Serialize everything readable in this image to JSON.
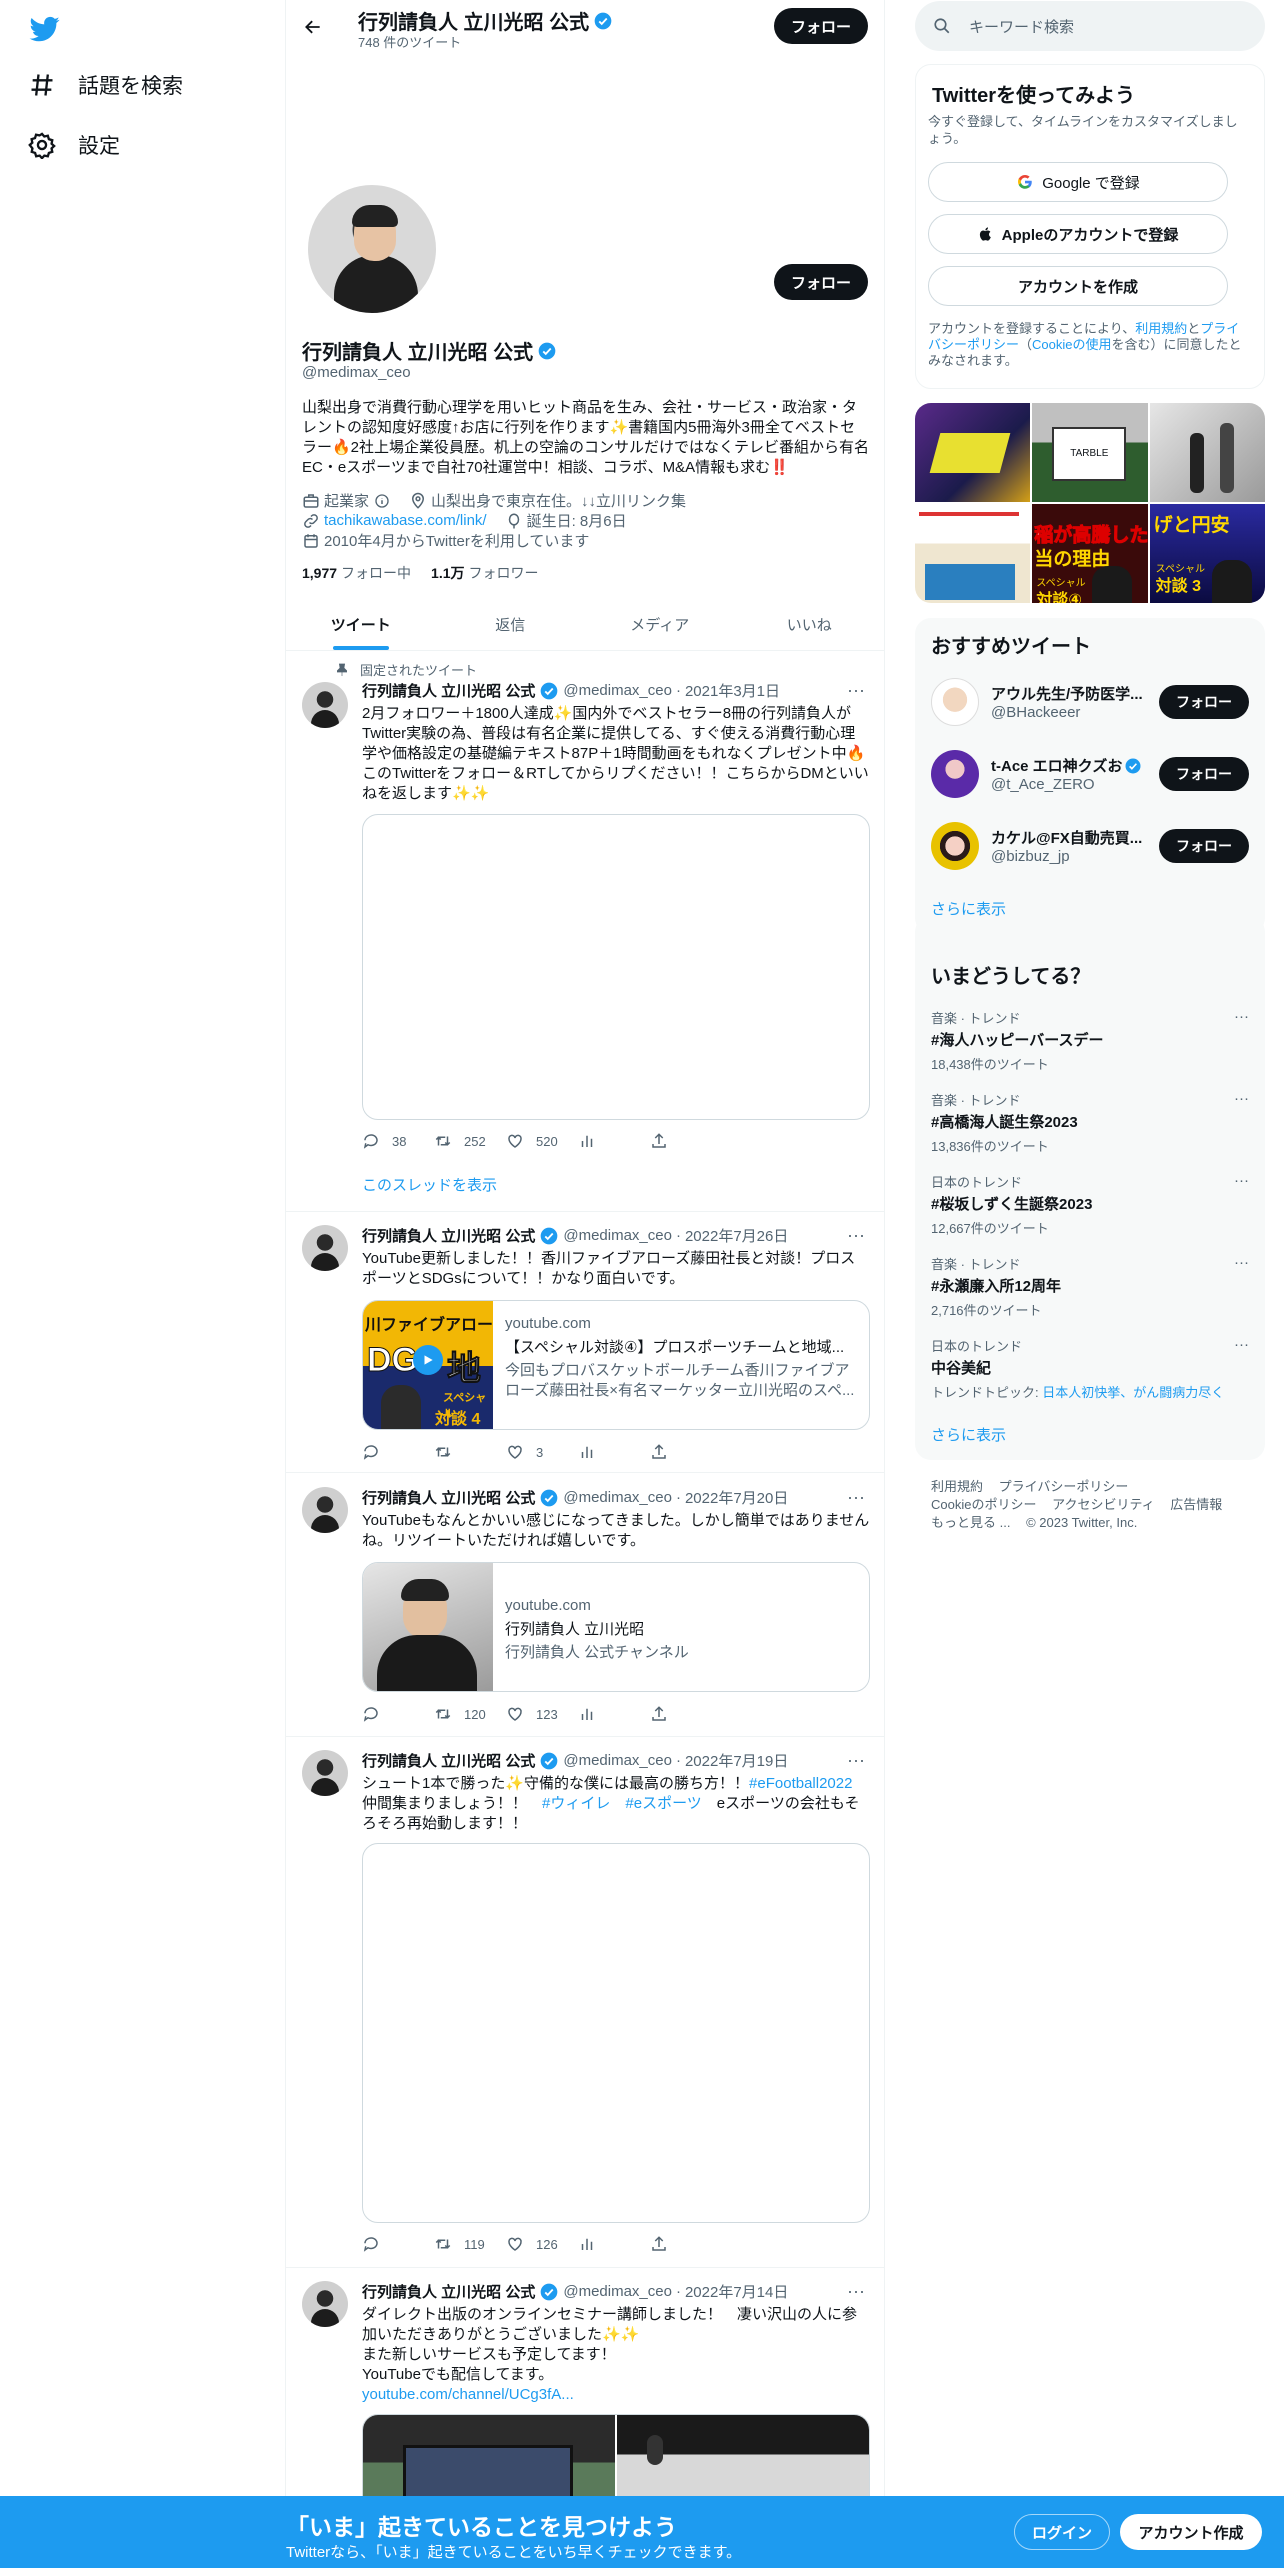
{
  "nav": {
    "explore_label": "話題を検索",
    "settings_label": "設定"
  },
  "header": {
    "title": "行列請負人 立川光昭 公式",
    "tweet_count": "748 件のツイート",
    "follow_label": "フォロー"
  },
  "profile": {
    "name": "行列請負人 立川光昭 公式",
    "handle": "@medimax_ceo",
    "follow_label": "フォロー",
    "bio": "山梨出身で消費行動心理学を用いヒット商品を生み、会社・サービス・政治家・タレントの認知度好感度↑お店に行列を作ります✨書籍国内5冊海外3冊全てベストセラー🔥2社上場企業役員歴。机上の空論のコンサルだけではなくテレビ番組から有名EC・eスポーツまで自社70社運営中！相談、コラボ、M&A情報も求む‼️",
    "profession": "起業家",
    "location": "山梨出身で東京在住。↓↓立川リンク集",
    "url": "tachikawabase.com/link/",
    "birthday": "誕生日: 8月6日",
    "joined": "2010年4月からTwitterを利用しています",
    "following_count": "1,977",
    "following_label": "フォロー中",
    "followers_count": "1.1万",
    "followers_label": "フォロワー"
  },
  "tabs": [
    "ツイート",
    "返信",
    "メディア",
    "いいね"
  ],
  "tweets": [
    {
      "pinned_label": "固定されたツイート",
      "name": "行列請負人 立川光昭 公式",
      "handle": "@medimax_ceo",
      "date": "2021年3月1日",
      "text": "2月フォロワー＋1800人達成✨国内外でベストセラー8冊の行列請負人がTwitter実験の為、普段は有名企業に提供してる、すぐ使える消費行動心理学や価格設定の基礎編テキスト87P＋1時間動画をもれなくプレゼント中🔥このTwitterをフォロー＆RTしてからリプください！！こちらからDMといいねを返します✨✨",
      "replies": "38",
      "retweets": "252",
      "likes": "520",
      "thread_link": "このスレッドを表示"
    },
    {
      "name": "行列請負人 立川光昭 公式",
      "handle": "@medimax_ceo",
      "date": "2022年7月26日",
      "text": "YouTube更新しました！！香川ファイブアローズ藤田社長と対談！プロスポーツとSDGsについて！！かなり面白いです。",
      "card_domain": "youtube.com",
      "card_title": "【スペシャル対談④】プロスポーツチームと地域...",
      "card_desc": "今回もプロバスケットボールチーム香川ファイブアローズ藤田社長×有名マーケッター立川光昭のスペ...",
      "thumb_text_1": "川ファイブアロー",
      "thumb_text_2": "DG",
      "thumb_text_3": "地",
      "thumb_text_4": "スペシャル",
      "thumb_text_5": "対談 4",
      "replies": "",
      "retweets": "",
      "likes": "3"
    },
    {
      "name": "行列請負人 立川光昭 公式",
      "handle": "@medimax_ceo",
      "date": "2022年7月20日",
      "text": "YouTubeもなんとかいい感じになってきました。しかし簡単ではありませんね。リツイートいただければ嬉しいです。",
      "card_domain": "youtube.com",
      "card_title": "行列請負人 立川光昭",
      "card_desc": "行列請負人 公式チャンネル",
      "replies": "",
      "retweets": "120",
      "likes": "123"
    },
    {
      "name": "行列請負人 立川光昭 公式",
      "handle": "@medimax_ceo",
      "date": "2022年7月19日",
      "text_before": "シュート1本で勝った✨守備的な僕には最高の勝ち方！！",
      "hashtag1": "#eFootball2022",
      "text_mid": "仲間集まりましょう！！",
      "hashtag2": "#ウィイレ",
      "hashtag3": "#eスポーツ",
      "text_after": "eスポーツの会社もそろそろ再始動します！！",
      "replies": "",
      "retweets": "119",
      "likes": "126"
    },
    {
      "name": "行列請負人 立川光昭 公式",
      "handle": "@medimax_ceo",
      "date": "2022年7月14日",
      "text": "ダイレクト出版のオンラインセミナー講師しました！　凄い沢山の人に参加いただきありがとうございました✨✨\nまた新しいサービスも予定してます！\nYouTubeでも配信してます。",
      "link": "youtube.com/channel/UCg3fA..."
    }
  ],
  "search": {
    "placeholder": "キーワード検索"
  },
  "signup_panel": {
    "title": "Twitterを使ってみよう",
    "subtitle": "今すぐ登録して、タイムラインをカスタマイズしましょう。",
    "google_label": "Google で登録",
    "apple_label": "Appleのアカウントで登録",
    "create_label": "アカウントを作成",
    "legal_1": "アカウントを登録することにより、",
    "legal_terms": "利用規約",
    "legal_and": "と",
    "legal_privacy": "プライバシーポリシー",
    "legal_open": "（",
    "legal_cookie": "Cookieの使用",
    "legal_2": "を含む）に同意したとみなされます。"
  },
  "media_grid": {
    "tile_3_text": "げと円安",
    "tile_4_text": "稲が高騰した",
    "tile_4_sub": "当の理由",
    "tile_5_text": "スペシャル",
    "tile_5_sub": "対談④",
    "tile_6_text": "スペシャル",
    "tile_6_sub": "対談 3",
    "tile_2_text": "TARBLE"
  },
  "who_to_follow": {
    "title": "おすすめツイート",
    "users": [
      {
        "name": "アウル先生/予防医学...",
        "handle": "@BHackeeer",
        "verified": false
      },
      {
        "name": "t-Ace エロ神クズお",
        "handle": "@t_Ace_ZERO",
        "verified": true
      },
      {
        "name": "カケル@FX自動売買...",
        "handle": "@bizbuz_jp",
        "verified": false
      }
    ],
    "follow_label": "フォロー",
    "show_more": "さらに表示"
  },
  "trends": {
    "title": "いまどうしてる？",
    "items": [
      {
        "category": "音楽 · トレンド",
        "name": "#海人ハッピーバースデー",
        "count": "18,438件のツイート"
      },
      {
        "category": "音楽 · トレンド",
        "name": "#高橋海人誕生祭2023",
        "count": "13,836件のツイート"
      },
      {
        "category": "日本のトレンド",
        "name": "#桜坂しずく生誕祭2023",
        "count": "12,667件のツイート"
      },
      {
        "category": "音楽 · トレンド",
        "name": "#永瀬廉入所12周年",
        "count": "2,716件のツイート"
      },
      {
        "category": "日本のトレンド",
        "name": "中谷美紀",
        "topic_prefix": "トレンドトピック: ",
        "topic_links": "日本人初快挙、がん闘病力尽く"
      }
    ],
    "show_more": "さらに表示"
  },
  "footer": [
    "利用規約",
    "プライバシーポリシー",
    "Cookieのポリシー",
    "アクセシビリティ",
    "広告情報",
    "もっと見る ...",
    "© 2023 Twitter, Inc."
  ],
  "bottom_bar": {
    "title": "「いま」起きていることを見つけよう",
    "subtitle": "Twitterなら、「いま」起きていることをいち早くチェックできます。",
    "login_label": "ログイン",
    "signup_label": "アカウント作成"
  },
  "colors": {
    "accent": "#1d9bf0",
    "text": "#0f1419",
    "muted": "#536471"
  }
}
